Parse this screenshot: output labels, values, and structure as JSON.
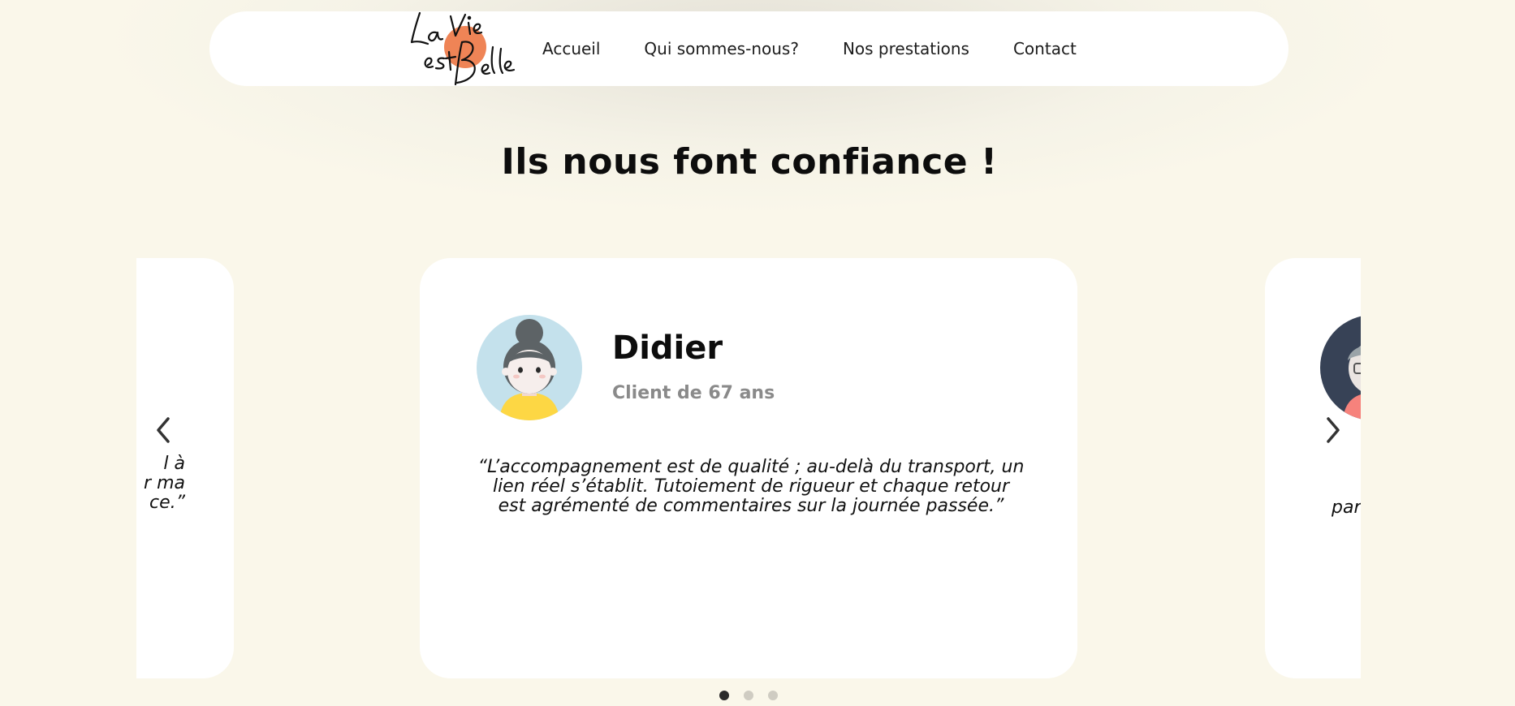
{
  "brand": {
    "logo_line1": "La Vie",
    "logo_line2": "est Belle",
    "accent_color": "#ef8456"
  },
  "nav": {
    "items": [
      {
        "label": "Accueil"
      },
      {
        "label": "Qui sommes-nous?"
      },
      {
        "label": "Nos prestations"
      },
      {
        "label": "Contact"
      }
    ]
  },
  "section": {
    "title": "Ils nous font confiance !"
  },
  "testimonials": {
    "previous": {
      "quote_lines": [
        "l à",
        "r ma",
        "ce.”"
      ]
    },
    "current": {
      "name": "Didier",
      "subtitle": "Client de 67 ans",
      "avatar_icon": "woman-avatar-icon",
      "quote": "“L’accompagnement est de qualité ; au-delà du transport, un lien réel s’établit. Tutoiement de rigueur et chaque retour est agrémenté de commentaires sur la journée passée.”"
    },
    "next": {
      "avatar_icon": "man-avatar-icon",
      "quote_line1": "“",
      "quote_line2": "par"
    }
  },
  "carousel": {
    "prev_icon": "chevron-left-icon",
    "next_icon": "chevron-right-icon",
    "active_index": 0,
    "dot_count": 3
  },
  "colors": {
    "background": "#faf7ea",
    "card": "#ffffff",
    "subtitle": "#8a8a8a"
  }
}
